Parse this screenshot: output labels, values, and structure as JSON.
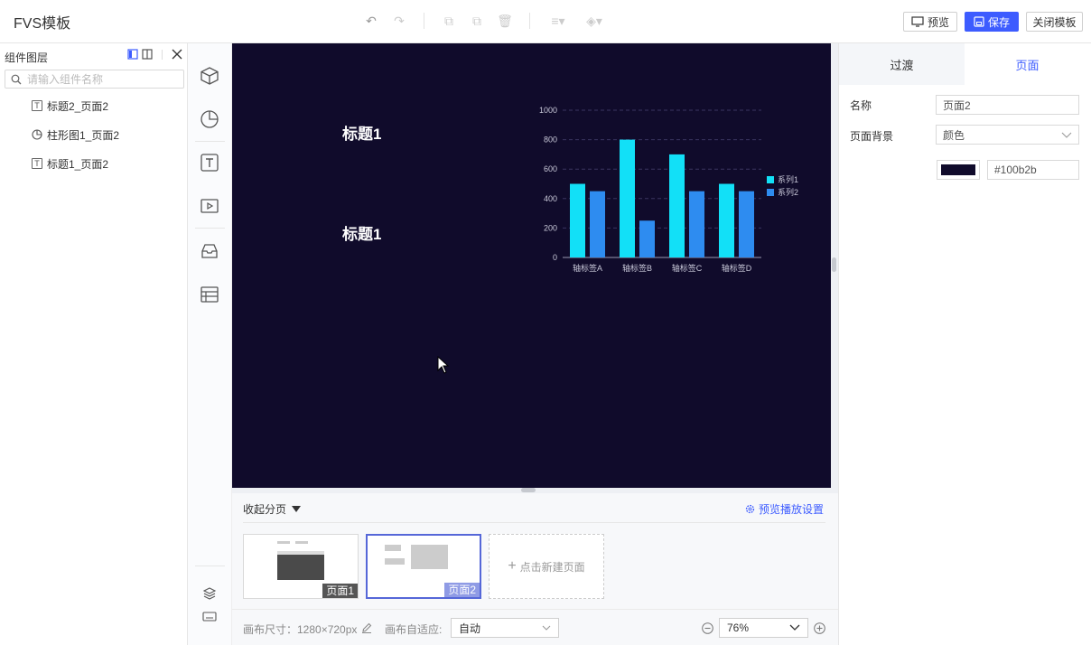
{
  "app": {
    "title": "FVS模板"
  },
  "toolbar": {
    "preview": "预览",
    "save": "保存",
    "close": "关闭模板"
  },
  "layers": {
    "title": "组件图层",
    "search_placeholder": "请输入组件名称",
    "items": [
      {
        "label": "标题2_页面2",
        "icon": "text-icon"
      },
      {
        "label": "柱形图1_页面2",
        "icon": "pie-icon"
      },
      {
        "label": "标题1_页面2",
        "icon": "text-icon"
      }
    ]
  },
  "canvas": {
    "background": "#100b2b",
    "titles": [
      "标题1",
      "标题1"
    ]
  },
  "chart_data": {
    "type": "bar",
    "categories": [
      "轴标签A",
      "轴标签B",
      "轴标签C",
      "轴标签D"
    ],
    "series": [
      {
        "name": "系列1",
        "values": [
          500,
          800,
          700,
          500
        ],
        "color": "#12e0f7"
      },
      {
        "name": "系列2",
        "values": [
          450,
          250,
          450,
          450
        ],
        "color": "#2e8cf0"
      }
    ],
    "yticks": [
      "0",
      "200",
      "400",
      "600",
      "800",
      "1000"
    ],
    "ylim": [
      0,
      1000
    ],
    "legend": "right",
    "grid": true
  },
  "pages": {
    "collapse_label": "收起分页",
    "settings_label": "预览播放设置",
    "thumbs": [
      {
        "label": "页面1"
      },
      {
        "label": "页面2"
      }
    ],
    "new_page_label": "点击新建页面"
  },
  "status": {
    "canvas_size": "画布尺寸：1280×720px",
    "fit_label": "画布自适应:",
    "fit_value": "自动",
    "zoom": "76%"
  },
  "right_panel": {
    "tabs": [
      "过渡",
      "页面"
    ],
    "name_label": "名称",
    "name_value": "页面2",
    "bg_label": "页面背景",
    "bg_type": "颜色",
    "bg_color": "#100b2b"
  },
  "colors": {
    "accent": "#3d5cff"
  }
}
